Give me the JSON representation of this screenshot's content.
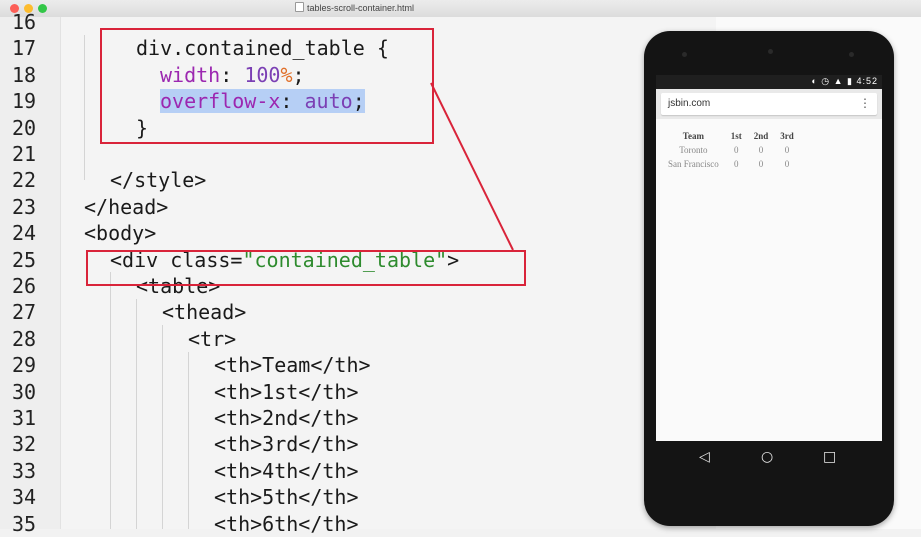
{
  "window": {
    "title": "tables-scroll-container.html"
  },
  "editor": {
    "line_numbers": [
      "16",
      "17",
      "18",
      "19",
      "20",
      "21",
      "22",
      "23",
      "24",
      "25",
      "26",
      "27",
      "28",
      "29",
      "30",
      "31",
      "32",
      "33",
      "34",
      "35"
    ],
    "lines": {
      "l17": {
        "selector": "div.contained_table {"
      },
      "l18": {
        "prop": "width",
        "colon": ": ",
        "num": "100",
        "unit": "%",
        "semi": ";"
      },
      "l19": {
        "prop": "overflow-x",
        "colon": ": ",
        "val": "auto",
        "semi": ";"
      },
      "l20": "}",
      "l22": "</style>",
      "l23": "</head>",
      "l24": "<body>",
      "l25": {
        "open": "<div class=",
        "attr": "\"contained_table\"",
        "close": ">"
      },
      "l26": "<table>",
      "l27": "<thead>",
      "l28": "<tr>",
      "l29": "<th>Team</th>",
      "l30": "<th>1st</th>",
      "l31": "<th>2nd</th>",
      "l32": "<th>3rd</th>",
      "l33": "<th>4th</th>",
      "l34": "<th>5th</th>",
      "l35": "<th>6th</th>"
    },
    "colors": {
      "highlight_box": "#d9243a",
      "property": "#9c27b0",
      "string": "#2e8b2e",
      "unit": "#e0702a",
      "selection": "#b6cff5"
    }
  },
  "phone": {
    "status": {
      "time": "4:52"
    },
    "browser": {
      "url": "jsbin.com",
      "menu_icon": "kebab-menu-icon"
    },
    "table": {
      "headers": [
        "Team",
        "1st",
        "2nd",
        "3rd"
      ],
      "rows": [
        [
          "Toronto",
          "0",
          "0",
          "0"
        ],
        [
          "San Francisco",
          "0",
          "0",
          "0"
        ]
      ]
    },
    "nav": {
      "back_icon": "back-triangle-icon",
      "home_icon": "home-circle-icon",
      "recents_icon": "recents-square-icon"
    }
  }
}
